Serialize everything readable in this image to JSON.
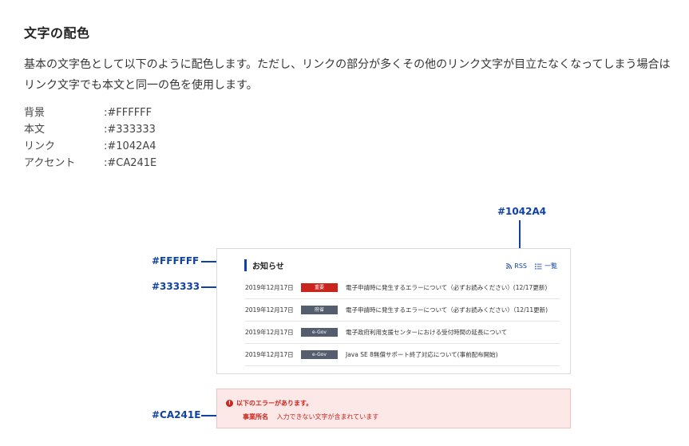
{
  "heading": "文字の配色",
  "intro": "基本の文字色として以下のように配色します。ただし、リンクの部分が多くその他のリンク文字が目立たなくなってしまう場合はリンク文字でも本文と同一の色を使用します。",
  "spec": [
    {
      "label": "背景",
      "value": ":#FFFFFF"
    },
    {
      "label": "本文",
      "value": ":#333333"
    },
    {
      "label": "リンク",
      "value": ":#1042A4"
    },
    {
      "label": "アクセント",
      "value": ":#CA241E"
    }
  ],
  "callouts": {
    "link": "#1042A4",
    "background": "#FFFFFF",
    "body": "#333333",
    "accent": "#CA241E"
  },
  "panel": {
    "title": "お知らせ",
    "rss_label": "RSS",
    "list_label": "一覧",
    "items": [
      {
        "date": "2019年12月17日",
        "badge": "重要",
        "badge_color": "#CA241E",
        "text": "電子申請時に発生するエラーについて（必ずお読みください）(12/17更新)"
      },
      {
        "date": "2019年12月17日",
        "badge": "府省",
        "badge_color": "#555e6e",
        "text": "電子申請時に発生するエラーについて（必ずお読みください）（12/11更新)"
      },
      {
        "date": "2019年12月17日",
        "badge": "e-Gov",
        "badge_color": "#555e6e",
        "text": "電子政府利用支援センターにおける受付時間の延長について"
      },
      {
        "date": "2019年12月17日",
        "badge": "e-Gov",
        "badge_color": "#555e6e",
        "text": "Java SE 8無償サポート終了対応について(事前配布開始)"
      }
    ]
  },
  "error": {
    "heading": "以下のエラーがあります。",
    "field": "事業所名",
    "message": "入力できない文字が含まれています"
  },
  "colors": {
    "background": "#FFFFFF",
    "body": "#333333",
    "link": "#1042A4",
    "accent": "#CA241E"
  }
}
